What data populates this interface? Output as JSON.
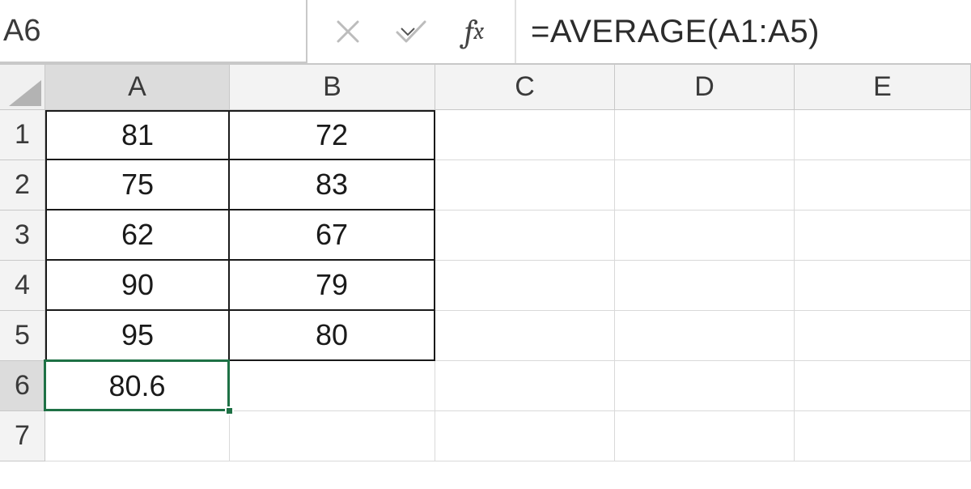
{
  "namebox": {
    "value": "A6"
  },
  "formula_bar": {
    "cancel_tooltip": "Cancel",
    "enter_tooltip": "Enter",
    "fx_label": "fx",
    "formula": "=AVERAGE(A1:A5)"
  },
  "columns": [
    "A",
    "B",
    "C",
    "D",
    "E"
  ],
  "rows": [
    "1",
    "2",
    "3",
    "4",
    "5",
    "6",
    "7"
  ],
  "active_cell": "A6",
  "grid": {
    "A1": "81",
    "B1": "72",
    "A2": "75",
    "B2": "83",
    "A3": "62",
    "B3": "67",
    "A4": "90",
    "B4": "79",
    "A5": "95",
    "B5": "80",
    "A6": "80.6"
  },
  "colors": {
    "selection_green": "#1e7145",
    "header_gray": "#f3f3f3",
    "active_header_gray": "#dcdcdc"
  }
}
